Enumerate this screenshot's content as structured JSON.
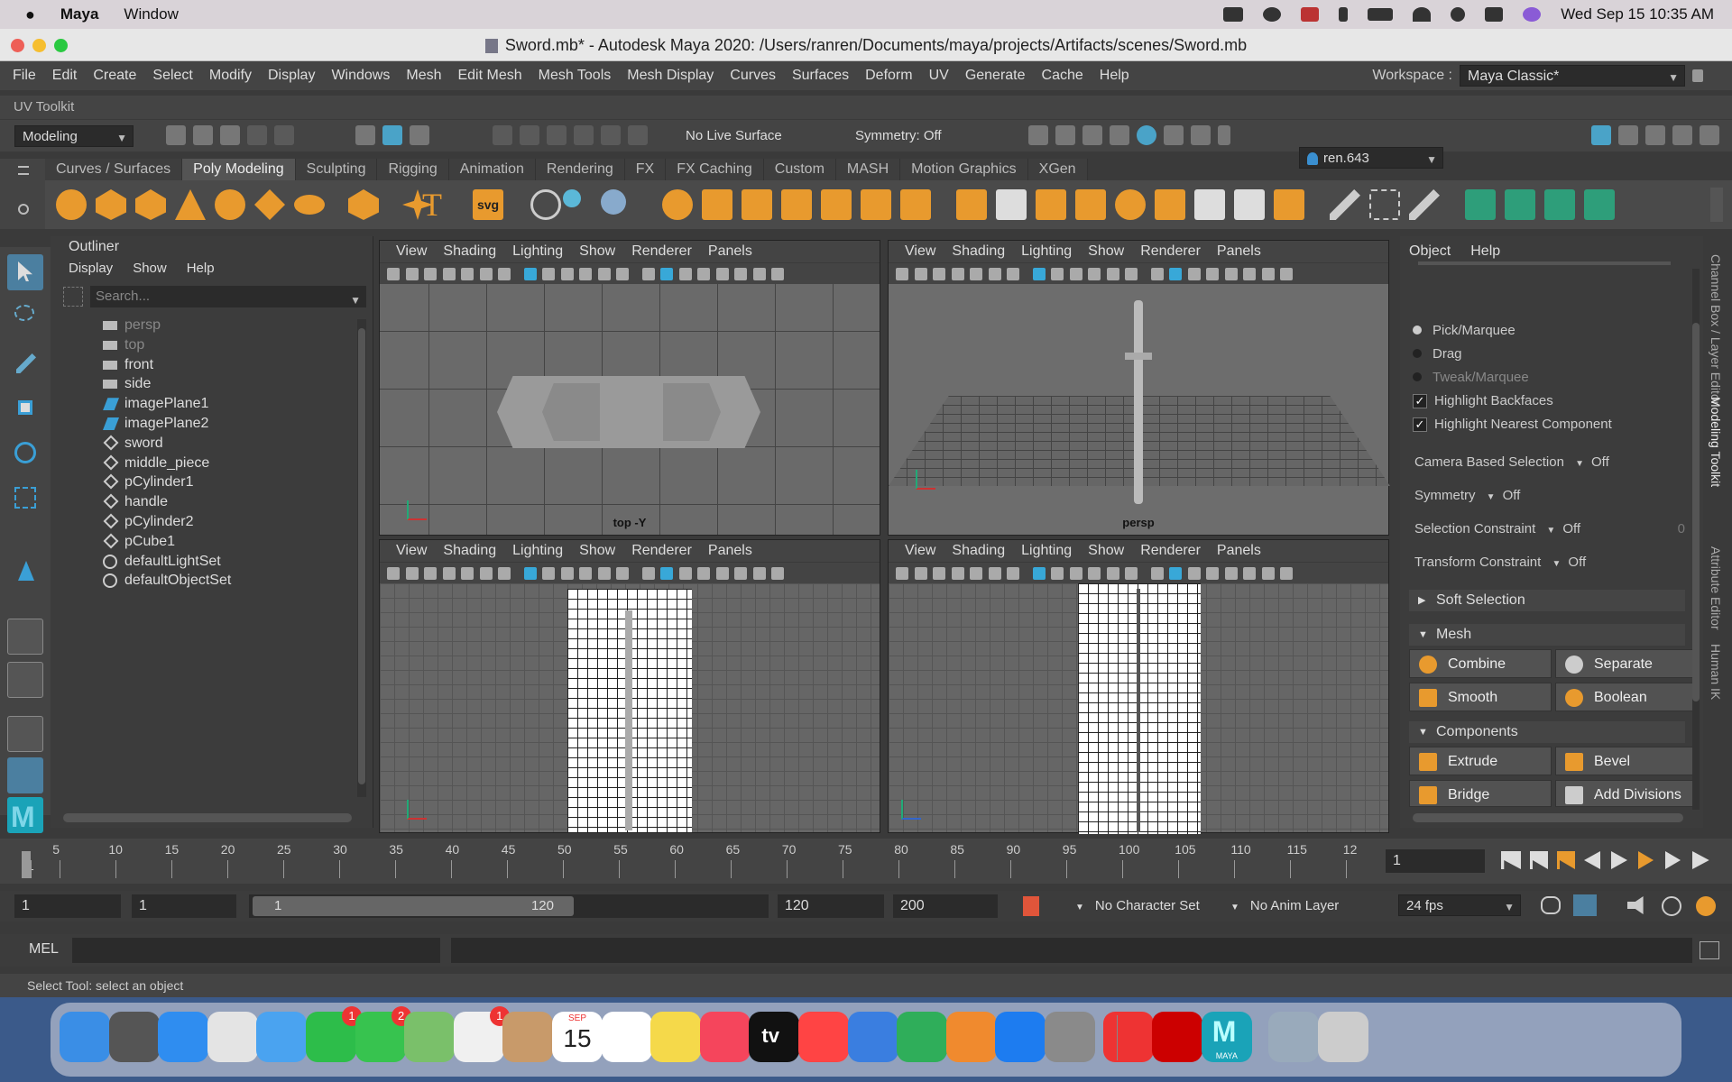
{
  "mac_menubar": {
    "apple_icon": "apple-icon",
    "app": "Maya",
    "menu": "Window",
    "datetime": "Wed Sep 15  10:35 AM"
  },
  "window": {
    "title": "Sword.mb* - Autodesk Maya 2020: /Users/ranren/Documents/maya/projects/Artifacts/scenes/Sword.mb"
  },
  "menubar": {
    "items": [
      "File",
      "Edit",
      "Create",
      "Select",
      "Modify",
      "Display",
      "Windows",
      "Mesh",
      "Edit Mesh",
      "Mesh Tools",
      "Mesh Display",
      "Curves",
      "Surfaces",
      "Deform",
      "UV",
      "Generate",
      "Cache",
      "Help"
    ],
    "workspace_label": "Workspace :",
    "workspace_value": "Maya Classic*"
  },
  "uv_toolkit": "UV Toolkit",
  "statusline": {
    "mode": "Modeling",
    "live_surface": "No Live Surface",
    "symmetry": "Symmetry: Off",
    "user": "ren.643"
  },
  "shelf": {
    "tabs": [
      "Curves / Surfaces",
      "Poly Modeling",
      "Sculpting",
      "Rigging",
      "Animation",
      "Rendering",
      "FX",
      "FX Caching",
      "Custom",
      "MASH",
      "Motion Graphics",
      "XGen"
    ],
    "active": "Poly Modeling",
    "text_icon": "T",
    "svg_icon": "svg"
  },
  "outliner": {
    "title": "Outliner",
    "menu": [
      "Display",
      "Show",
      "Help"
    ],
    "search_placeholder": "Search...",
    "items": [
      {
        "label": "persp",
        "icon": "camera-icon",
        "dim": true
      },
      {
        "label": "top",
        "icon": "camera-icon",
        "dim": true
      },
      {
        "label": "front",
        "icon": "camera-icon",
        "dim": false
      },
      {
        "label": "side",
        "icon": "camera-icon",
        "dim": false
      },
      {
        "label": "imagePlane1",
        "icon": "image-plane-icon",
        "dim": false
      },
      {
        "label": "imagePlane2",
        "icon": "image-plane-icon",
        "dim": false
      },
      {
        "label": "sword",
        "icon": "transform-icon",
        "dim": false
      },
      {
        "label": "middle_piece",
        "icon": "transform-icon",
        "dim": false
      },
      {
        "label": "pCylinder1",
        "icon": "transform-icon",
        "dim": false
      },
      {
        "label": "handle",
        "icon": "transform-icon",
        "dim": false
      },
      {
        "label": "pCylinder2",
        "icon": "transform-icon",
        "dim": false
      },
      {
        "label": "pCube1",
        "icon": "transform-icon",
        "dim": false
      },
      {
        "label": "defaultLightSet",
        "icon": "set-icon",
        "dim": false
      },
      {
        "label": "defaultObjectSet",
        "icon": "set-icon",
        "dim": false
      }
    ]
  },
  "viewports": {
    "menu": [
      "View",
      "Shading",
      "Lighting",
      "Show",
      "Renderer",
      "Panels"
    ],
    "top_left_label": "top -Y",
    "top_right_label": "persp"
  },
  "modeling_toolkit": {
    "menu": [
      "Object",
      "Help"
    ],
    "pick_marquee": "Pick/Marquee",
    "drag": "Drag",
    "tweak_marquee": "Tweak/Marquee",
    "highlight_backfaces": "Highlight Backfaces",
    "highlight_nearest": "Highlight Nearest Component",
    "camera_based": "Camera Based Selection",
    "camera_based_val": "Off",
    "symmetry": "Symmetry",
    "symmetry_val": "Off",
    "selection_constraint": "Selection Constraint",
    "selection_constraint_val": "Off",
    "selection_constraint_num": "0",
    "transform_constraint": "Transform Constraint",
    "transform_constraint_val": "Off",
    "soft_selection": "Soft Selection",
    "mesh": "Mesh",
    "combine": "Combine",
    "separate": "Separate",
    "smooth": "Smooth",
    "boolean": "Boolean",
    "components": "Components",
    "extrude": "Extrude",
    "bevel": "Bevel",
    "bridge": "Bridge",
    "add_divisions": "Add Divisions"
  },
  "side_tabs": [
    "Channel Box / Layer Editor",
    "Modeling Toolkit",
    "Attribute Editor",
    "Human IK"
  ],
  "timeline": {
    "ticks": [
      "1",
      "5",
      "10",
      "15",
      "20",
      "25",
      "30",
      "35",
      "40",
      "45",
      "50",
      "55",
      "60",
      "65",
      "70",
      "75",
      "80",
      "85",
      "90",
      "95",
      "100",
      "105",
      "110",
      "115",
      "12"
    ],
    "current": "1"
  },
  "range": {
    "start": "1",
    "start2": "1",
    "slider_start": "1",
    "slider_end": "120",
    "end": "120",
    "end2": "200",
    "character_set": "No Character Set",
    "anim_layer": "No Anim Layer",
    "fps": "24 fps"
  },
  "cmdline": {
    "lang": "MEL"
  },
  "helpline": "Select Tool: select an object",
  "dock": {
    "calendar_month": "SEP",
    "calendar_day": "15",
    "facetime_badge": "1",
    "messages_badge": "2",
    "photos_badge": "1",
    "tv_label": "tv",
    "maya_label": "MAYA",
    "apps": [
      "finder-icon",
      "launchpad-icon",
      "safari-icon",
      "chrome-icon",
      "mail-icon",
      "facetime-icon",
      "messages-icon",
      "maps-icon",
      "photos-icon",
      "contacts-icon",
      "calendar-icon",
      "reminders-icon",
      "notes-icon",
      "music-icon",
      "tv-icon",
      "news-icon",
      "keynote-icon",
      "numbers-icon",
      "pages-icon",
      "appstore-icon",
      "settings-icon",
      "netease-icon",
      "acrobat-icon",
      "maya-icon",
      "preview-icon",
      "trash-icon"
    ]
  }
}
